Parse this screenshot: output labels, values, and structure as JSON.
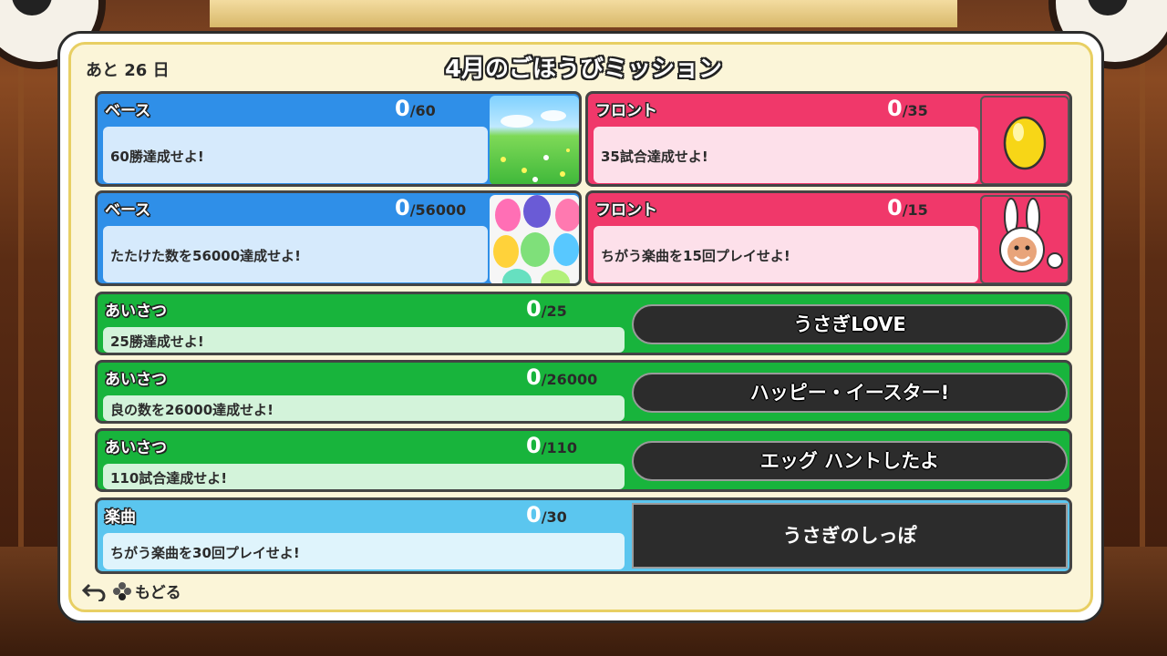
{
  "header": {
    "days_left": "あと 26 日",
    "title": "4月のごほうびミッション"
  },
  "missions_top": [
    {
      "tag": "ベース",
      "current": "0",
      "total": "/60",
      "description": "60勝達成せよ!",
      "reward_icon": "meadow-image"
    },
    {
      "tag": "フロント",
      "current": "0",
      "total": "/35",
      "description": "35試合達成せよ!",
      "reward_icon": "golden-egg-icon"
    },
    {
      "tag": "ベース",
      "current": "0",
      "total": "/56000",
      "description": "たたけた数を56000達成せよ!",
      "reward_icon": "easter-eggs-image"
    },
    {
      "tag": "フロント",
      "current": "0",
      "total": "/15",
      "description": "ちがう楽曲を15回プレイせよ!",
      "reward_icon": "bunny-character-image"
    }
  ],
  "missions_wide": [
    {
      "tag": "あいさつ",
      "current": "0",
      "total": "/25",
      "description": "25勝達成せよ!",
      "reward": "うさぎLOVE"
    },
    {
      "tag": "あいさつ",
      "current": "0",
      "total": "/26000",
      "description": "良の数を26000達成せよ!",
      "reward": "ハッピー・イースター!"
    },
    {
      "tag": "あいさつ",
      "current": "0",
      "total": "/110",
      "description": "110試合達成せよ!",
      "reward": "エッグ ハントしたよ"
    },
    {
      "tag": "楽曲",
      "current": "0",
      "total": "/30",
      "description": "ちがう楽曲を30回プレイせよ!",
      "reward": "うさぎのしっぽ"
    }
  ],
  "footer": {
    "back_label": "もどる"
  },
  "colors": {
    "base": "#2f8fe8",
    "front": "#f0386a",
    "greeting": "#18b43c",
    "song": "#5bc6ef",
    "frame": "#e8cf63"
  }
}
